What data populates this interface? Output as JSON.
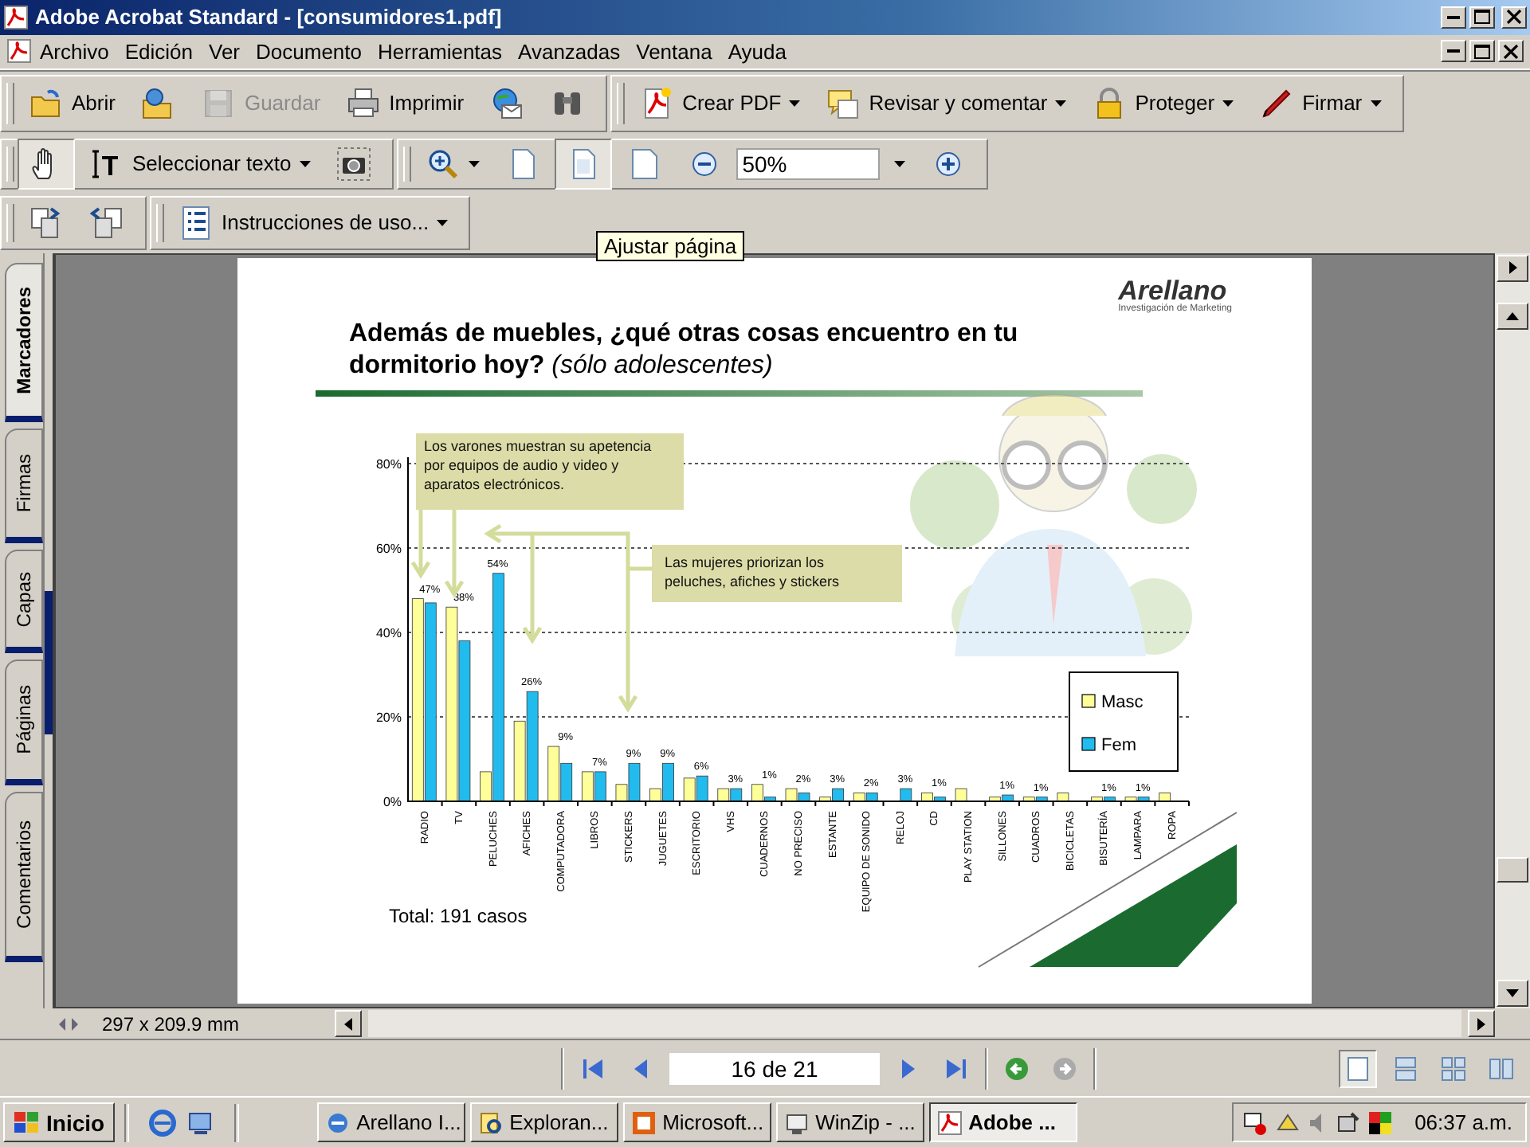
{
  "window": {
    "title": "Adobe Acrobat Standard - [consumidores1.pdf]"
  },
  "menu": {
    "items": [
      "Archivo",
      "Edición",
      "Ver",
      "Documento",
      "Herramientas",
      "Avanzadas",
      "Ventana",
      "Ayuda"
    ]
  },
  "toolbars": [
    [
      [
        {
          "kind": "button",
          "label": "Abrir",
          "selected": false,
          "disabled": false
        },
        {
          "kind": "button",
          "selected": false,
          "disabled": false
        },
        {
          "kind": "button",
          "label": "Guardar",
          "selected": false,
          "disabled": true
        },
        {
          "kind": "button",
          "label": "Imprimir",
          "selected": false,
          "disabled": false
        },
        {
          "kind": "button",
          "selected": false,
          "disabled": false
        },
        {
          "kind": "button",
          "selected": false,
          "disabled": false
        }
      ],
      [
        {
          "kind": "menu",
          "label": "Crear PDF",
          "selected": false,
          "disabled": false
        },
        {
          "kind": "menu",
          "label": "Revisar y comentar",
          "selected": false,
          "disabled": false
        },
        {
          "kind": "menu",
          "label": "Proteger",
          "selected": false,
          "disabled": false
        },
        {
          "kind": "menu",
          "label": "Firmar",
          "selected": false,
          "disabled": false
        }
      ]
    ],
    [
      [
        {
          "kind": "button",
          "selected": true,
          "disabled": false
        },
        {
          "kind": "menu",
          "label": "Seleccionar texto",
          "selected": false,
          "disabled": false
        },
        {
          "kind": "button",
          "selected": false,
          "disabled": false
        }
      ],
      [
        {
          "kind": "menu",
          "selected": false,
          "disabled": false
        },
        {
          "kind": "button",
          "selected": false,
          "disabled": false
        },
        {
          "kind": "button",
          "selected": true,
          "disabled": false
        },
        {
          "kind": "button",
          "selected": false,
          "disabled": false
        },
        {
          "kind": "button",
          "selected": false,
          "disabled": false
        },
        {
          "kind": "field",
          "value": "50%"
        },
        {
          "kind": "button",
          "selected": false,
          "disabled": false
        }
      ]
    ],
    [
      [
        {
          "kind": "button",
          "selected": false,
          "disabled": false
        },
        {
          "kind": "button",
          "selected": false,
          "disabled": false
        }
      ],
      [
        {
          "kind": "menu",
          "label": "Instrucciones de uso...",
          "selected": false,
          "disabled": false
        }
      ]
    ]
  ],
  "tooltip": {
    "text": "Ajustar página"
  },
  "side_tabs": [
    {
      "label": "Marcadores",
      "selected": true
    },
    {
      "label": "Firmas",
      "selected": false
    },
    {
      "label": "Capas",
      "selected": false
    },
    {
      "label": "Páginas",
      "selected": false
    },
    {
      "label": "Comentarios",
      "selected": false
    }
  ],
  "document": {
    "logo": {
      "name": "Arellano",
      "tagline": "Investigación de Marketing"
    },
    "title": "Además de muebles, ¿qué otras cosas encuentro en tu dormitorio hoy? *(sólo adolescentes)*",
    "chart_data": {
      "type": "bar",
      "categories": [
        "RADIO",
        "TV",
        "PELUCHES",
        "AFICHES",
        "COMPUTADORA",
        "LIBROS",
        "STICKERS",
        "JUGUETES",
        "ESCRITORIO",
        "VHS",
        "CUADERNOS",
        "NO PRECISO",
        "ESTANTE",
        "EQUIPO DE SONIDO",
        "RELOJ",
        "CD",
        "PLAY STATION",
        "SILLONES",
        "CUADROS",
        "BICICLETAS",
        "BISUTERÍA",
        "LAMPARA",
        "ROPA"
      ],
      "series": [
        {
          "name": "Masc",
          "color": "#ffff99",
          "values": [
            48,
            46,
            7,
            19,
            13,
            7,
            4,
            3,
            5.5,
            3,
            4,
            3,
            1,
            2,
            0,
            2,
            3,
            1,
            1,
            2,
            1,
            1,
            2
          ]
        },
        {
          "name": "Fem",
          "color": "#22bbee",
          "values": [
            47,
            38,
            54,
            26,
            9,
            7,
            9,
            9,
            6,
            3,
            1,
            2,
            3,
            2,
            3,
            1,
            0,
            1.5,
            1,
            0,
            1,
            1,
            0
          ]
        }
      ],
      "ylim": [
        0,
        80
      ],
      "grid": true,
      "legend": true,
      "yticks": [
        {
          "value": 0,
          "label": "0%"
        },
        {
          "value": 20,
          "label": "20%"
        },
        {
          "value": 40,
          "label": "40%"
        },
        {
          "value": 60,
          "label": "60%"
        },
        {
          "value": 80,
          "label": "80%"
        }
      ],
      "value_labels": [
        "47%",
        "38%",
        "54%",
        "26%",
        "9%",
        "7%",
        "9%",
        "9%",
        "6%",
        "3%",
        "1%",
        "2%",
        "3%",
        "2%",
        "3%",
        "1%",
        null,
        "1%",
        "1%",
        null,
        "1%",
        "1%",
        null
      ],
      "annotations": [
        {
          "text": "Los varones muestran su apetencia por equipos de audio y video y aparatos electrónicos."
        },
        {
          "text": "Las mujeres priorizan los peluches, afiches y stickers"
        }
      ]
    },
    "total": "Total: 191 casos"
  },
  "status": {
    "page_size": "297 x 209.9 mm"
  },
  "page_nav": {
    "page_field": "16 de 21",
    "views": [
      {
        "selected": true
      },
      {
        "selected": false
      },
      {
        "selected": false
      },
      {
        "selected": false
      }
    ]
  },
  "taskbar": {
    "start": "Inicio",
    "tasks": [
      {
        "label": "Arellano I...",
        "selected": false
      },
      {
        "label": "Exploran...",
        "selected": false
      },
      {
        "label": "Microsoft...",
        "selected": false
      },
      {
        "label": "WinZip - ...",
        "selected": false
      },
      {
        "label": "Adobe ...",
        "selected": true
      }
    ],
    "clock": "06:37 a.m."
  }
}
